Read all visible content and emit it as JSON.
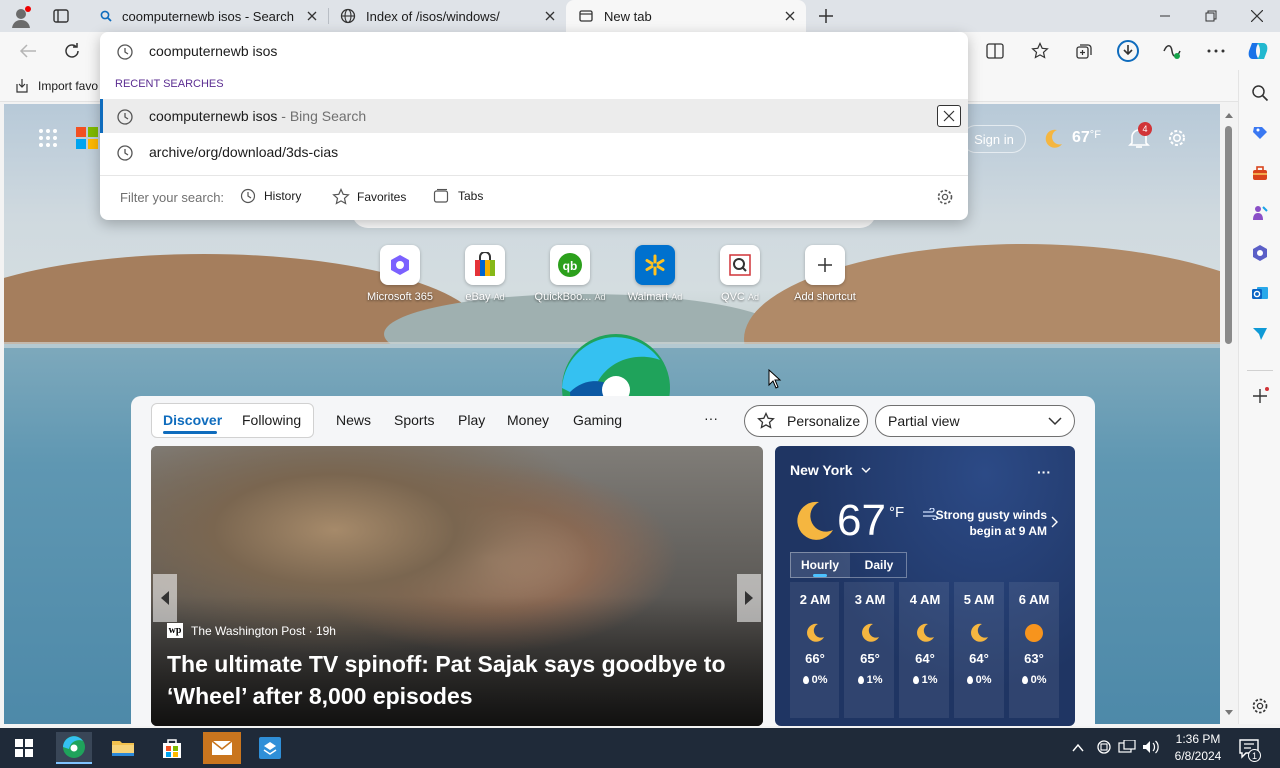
{
  "tabs": [
    {
      "title": "coomputernewb isos - Search"
    },
    {
      "title": "Index of /isos/windows/"
    },
    {
      "title": "New tab"
    }
  ],
  "favorites": {
    "import_label": "Import favo"
  },
  "omnibox": {
    "query": "coomputernewb isos",
    "section_label": "RECENT SEARCHES",
    "suggestions": [
      {
        "text": "coomputernewb isos",
        "suffix": " - Bing Search"
      },
      {
        "text": "archive/org/download/3ds-cias",
        "suffix": ""
      }
    ],
    "filter_label": "Filter your search:",
    "filters": [
      "History",
      "Favorites",
      "Tabs"
    ]
  },
  "header": {
    "sign_in": "Sign in",
    "temp": "67",
    "unit": "°F",
    "notifications": "4"
  },
  "shortcuts": [
    {
      "label": "Microsoft 365",
      "ad": ""
    },
    {
      "label": "eBay",
      "ad": "Ad"
    },
    {
      "label": "QuickBoo...",
      "ad": "Ad"
    },
    {
      "label": "Walmart",
      "ad": "Ad"
    },
    {
      "label": "QVC",
      "ad": "Ad"
    },
    {
      "label": "Add shortcut",
      "ad": ""
    }
  ],
  "feed_nav": {
    "discover": "Discover",
    "following": "Following",
    "items": [
      "News",
      "Sports",
      "Play",
      "Money",
      "Gaming"
    ],
    "more": "···",
    "personalize": "Personalize",
    "view_mode": "Partial view"
  },
  "hero": {
    "source": "The Washington Post · 19h",
    "headline": "The ultimate TV spinoff: Pat Sajak says goodbye to ‘Wheel’ after 8,000 episodes"
  },
  "weather": {
    "location": "New York",
    "temp": "67",
    "unit": "°F",
    "alert": "Strong gusty winds begin at 9 AM",
    "tabs": [
      "Hourly",
      "Daily"
    ],
    "hours": [
      {
        "time": "2 AM",
        "temp": "66°",
        "precip": "0%",
        "icon": "moon"
      },
      {
        "time": "3 AM",
        "temp": "65°",
        "precip": "1%",
        "icon": "moon"
      },
      {
        "time": "4 AM",
        "temp": "64°",
        "precip": "1%",
        "icon": "moon"
      },
      {
        "time": "5 AM",
        "temp": "64°",
        "precip": "0%",
        "icon": "moon"
      },
      {
        "time": "6 AM",
        "temp": "63°",
        "precip": "0%",
        "icon": "sun"
      }
    ]
  },
  "taskbar": {
    "time": "1:36 PM",
    "date": "6/8/2024",
    "notif_count": "1"
  },
  "colors": {
    "accent": "#0f6cbd",
    "weather_bg": "#1f3563",
    "taskbar": "#1f2a39"
  }
}
